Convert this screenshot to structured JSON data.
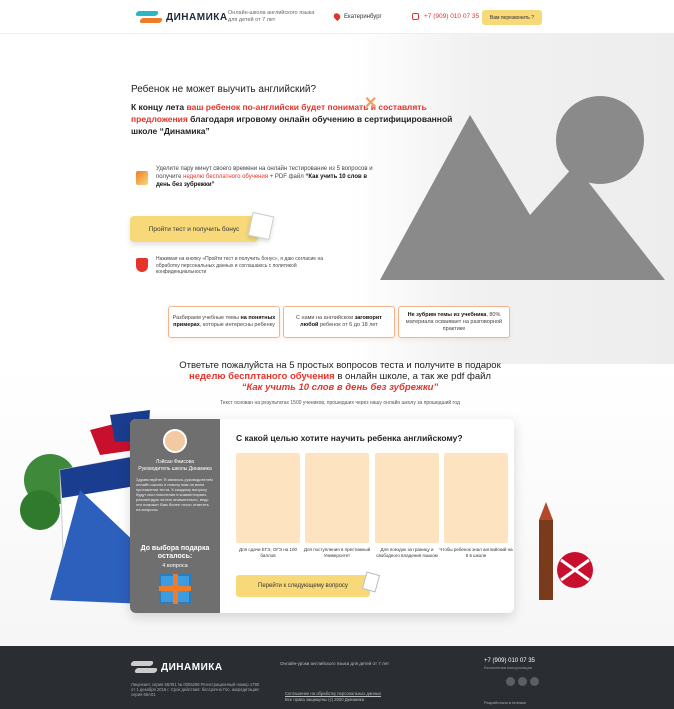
{
  "header": {
    "logo": "ДИНАМИКА",
    "tagline": "Онлайн-школа английского языка для детей от 7 лет",
    "city": "Екатеринбург",
    "phone": "+7 (909) 010 07 35",
    "callback": "Вам перезвонить ?"
  },
  "hero": {
    "question": "Ребенок не может выучить английский?",
    "line1": "К концу лета ",
    "line1_red": "ваш ребенок по-английски будет понимать и составлять предложения",
    "line2": " благодаря игровому онлайн обучению в сертифицированной школе “Динамика”",
    "offer_text1": "Уделите пару минут своего времени на онлайн тестирование из 5 вопросов и получите ",
    "offer_red": "неделю бесплатного обучения",
    "offer_text2": " + PDF файл ",
    "offer_bold": "“Как учить 10 слов в день без зубрежки”",
    "test_button": "Пройти тест и получить бонус",
    "consent": "Нажимая на кнопку «Пройти тест и получить бонус», я даю согласие на обработку персональных данных и соглашаюсь c политикой конфиденциальности"
  },
  "features": [
    {
      "pre": "Разбираем учебные темы ",
      "bold": "на понятных примерах",
      "post": ", которые интересны ребенку"
    },
    {
      "pre": "С нами на английском ",
      "bold": "заговорит любой",
      "post": " ребенок от 6 до 18 лет"
    },
    {
      "pre": "",
      "bold": "Не зубрим темы из учебника",
      "post": ", 80% материала осваивает на разговорной практике"
    }
  ],
  "cta": {
    "line1": "Ответьте пожалуйста на 5 простых вопросов теста и получите в подарок",
    "red": "неделю бесплтаного обучения",
    "line2": " в онлайн школе,  а так же pdf файл",
    "italic": "“Как учить  10 слов в день без зубрежки”",
    "sub": "Текст основан на результатах 1500 учеников, прошедших через нашу онлайн школу за прошедший год"
  },
  "quiz": {
    "manager_name": "Лэйсан Фаисова",
    "manager_role": "Руководитель школы Динамика",
    "manager_text": "Здравствуйте! Я являюсь руководителем онлайн школы и помогу вам на всем протяжении теста. К каждому вопросу будут мои пояснения в комментариях, рекомендую читать внимательно, ведь это поможет Вам более точно ответить на вопросы.",
    "remaining_label": "До выбора подарка осталось:",
    "remaining_count": "4 вопроса",
    "question": "С какой целью хотите научить ребенка английскому?",
    "answers": [
      "Для сдачи ЕГЭ, ОГЭ на 100 баллов",
      "Для поступления в престижный Университет",
      "Для поездок за границу и свободного владения языком",
      "Чтобы ребенок знал английский на 5 в школе"
    ],
    "next_button": "Перейти к следующему вопросу"
  },
  "footer": {
    "logo": "ДИНАМИКА",
    "tagline": "Онлайн-уроки английского языка для детей от 7 лет",
    "legal": "Лицензия: серия 66Л01 № 0005296 Регистрационный номер 1790 от 1 декабря 2016 г. Срок действия: бессрочно Гос. аккредитация: серия 66А01",
    "privacy": "Соглашение на обработку персональных данных",
    "copyright": "Все права защищены (с) 2020 Динамика",
    "phone": "+7 (909) 010 07 35",
    "phone_note": "Бесплатная консультация",
    "developer": "Разработано в leobase"
  },
  "colors": {
    "accent": "#f7d97a",
    "red": "#e5332a",
    "orange": "#f07c28",
    "footer": "#2a2e33"
  }
}
